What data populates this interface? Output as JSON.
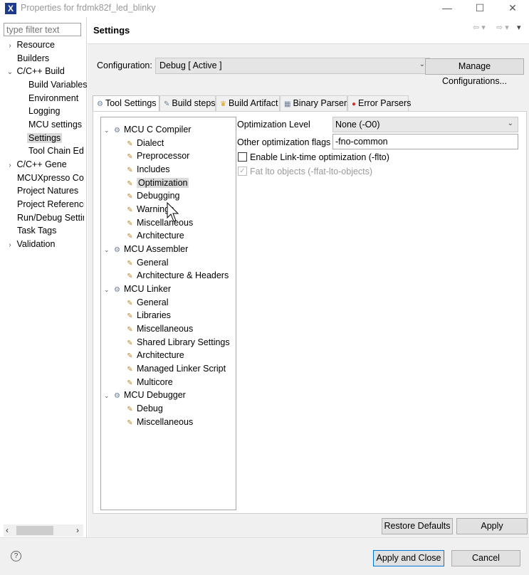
{
  "window": {
    "title": "Properties for frdmk82f_led_blinky",
    "min": "—",
    "max": "☐",
    "close": "✕"
  },
  "filter": {
    "placeholder": "type filter text"
  },
  "left_tree": [
    {
      "label": "Resource",
      "chev": "›"
    },
    {
      "label": "Builders",
      "chev": ""
    },
    {
      "label": "C/C++ Build",
      "chev": "⌄"
    },
    {
      "label": "Build Variables",
      "chev": ""
    },
    {
      "label": "Environment",
      "chev": ""
    },
    {
      "label": "Logging",
      "chev": ""
    },
    {
      "label": "MCU settings",
      "chev": ""
    },
    {
      "label": "Settings",
      "chev": ""
    },
    {
      "label": "Tool Chain Edi",
      "chev": ""
    },
    {
      "label": "C/C++ Gene",
      "chev": "›"
    },
    {
      "label": "MCUXpresso Co",
      "chev": ""
    },
    {
      "label": "Project Natures",
      "chev": ""
    },
    {
      "label": "Project Reference",
      "chev": ""
    },
    {
      "label": "Run/Debug Settir",
      "chev": ""
    },
    {
      "label": "Task Tags",
      "chev": ""
    },
    {
      "label": "Validation",
      "chev": "›"
    }
  ],
  "header": {
    "title": "Settings"
  },
  "config": {
    "label": "Configuration:",
    "value": "Debug  [ Active ]",
    "manage": "Manage Configurations..."
  },
  "tabs": [
    "Tool Settings",
    "Build steps",
    "Build Artifact",
    "Binary Parsers",
    "Error Parsers"
  ],
  "opt_tree": {
    "mcu_c_compiler": "MCU C Compiler",
    "dialect": "Dialect",
    "preprocessor": "Preprocessor",
    "includes": "Includes",
    "optimization": "Optimization",
    "debugging": "Debugging",
    "warnings": "Warnings",
    "misc": "Miscellaneous",
    "architecture": "Architecture",
    "mcu_assembler": "MCU Assembler",
    "asm_general": "General",
    "asm_arch_headers": "Architecture & Headers",
    "mcu_linker": "MCU Linker",
    "lnk_general": "General",
    "lnk_libraries": "Libraries",
    "lnk_misc": "Miscellaneous",
    "lnk_shared": "Shared Library Settings",
    "lnk_arch": "Architecture",
    "lnk_script": "Managed Linker Script",
    "lnk_multicore": "Multicore",
    "mcu_debugger": "MCU Debugger",
    "dbg_debug": "Debug",
    "dbg_misc": "Miscellaneous"
  },
  "optimization": {
    "level_label": "Optimization Level",
    "level_value": "None (-O0)",
    "flags_label": "Other optimization flags",
    "flags_value": "-fno-common",
    "lto_label": "Enable Link-time optimization (-flto)",
    "fat_lto_label": "Fat lto objects (-ffat-lto-objects)"
  },
  "buttons": {
    "restore": "Restore Defaults",
    "apply": "Apply",
    "apply_close": "Apply and Close",
    "cancel": "Cancel"
  }
}
